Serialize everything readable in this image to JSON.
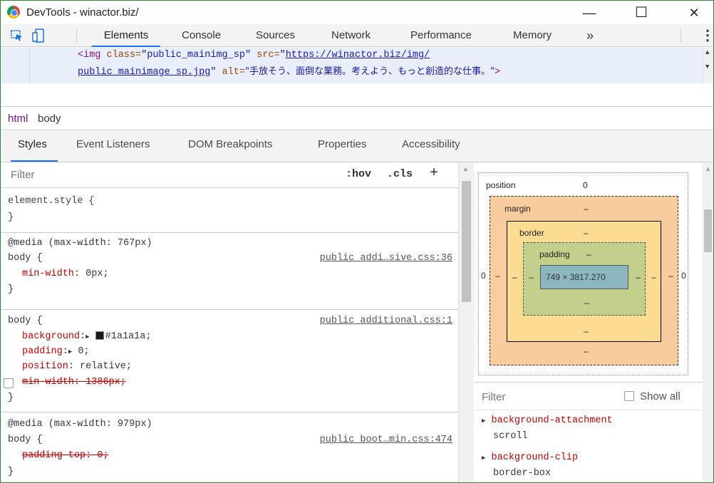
{
  "title": "DevTools - winactor.biz/",
  "window_controls": {
    "minimize": "—",
    "maximize": "☐",
    "close": "✕"
  },
  "tabs": [
    "Elements",
    "Console",
    "Sources",
    "Network",
    "Performance",
    "Memory"
  ],
  "more_tabs": "»",
  "kebab": "⋮",
  "dom": {
    "line1_tag": "<img",
    "line1_attr1": " class=",
    "line1_val1": "\"public_mainimg_sp\"",
    "line1_attr2": " src=",
    "line1_val2": "\"",
    "line1_link": "https://winactor.biz/img/",
    "line2_link": "public_mainimage_sp.jpg",
    "line2_val": "\"",
    "line2_attr": " alt=",
    "line2_alt": "\"手放そう、面倒な業務。考えよう、もっと創造的な仕事。\"",
    "line2_end": ">"
  },
  "breadcrumbs": [
    "html",
    "body"
  ],
  "subtabs": [
    "Styles",
    "Event Listeners",
    "DOM Breakpoints",
    "Properties",
    "Accessibility"
  ],
  "filter_placeholder": "Filter",
  "hov": ":hov",
  "cls": ".cls",
  "plus": "+",
  "rules": {
    "r1": {
      "l1": "element.style {",
      "l2": "}"
    },
    "r2": {
      "media": "@media (max-width: 767px)",
      "sel": "body {",
      "src": "public_addi…sive.css:36",
      "p1n": "min-width",
      "p1v": ": 0px;",
      "end": "}"
    },
    "r3": {
      "sel": "body {",
      "src": "public_additional.css:1",
      "p1n": "background",
      "p1v": "#1a1a1a;",
      "p2n": "padding",
      "p2v": "0;",
      "p3n": "position",
      "p3v": ": relative;",
      "p4": "min-width: 1386px;",
      "end": "}",
      "arrow": "▶"
    },
    "r4": {
      "media": "@media (max-width: 979px)",
      "sel": "body {",
      "src": "public_boot…min.css:474",
      "p1": "padding-top: 0;",
      "end": "}"
    }
  },
  "box_model": {
    "position_label": "position",
    "position_value": "0",
    "margin_label": "margin",
    "margin_value": "–",
    "border_label": "border",
    "border_value": "–",
    "padding_label": "padding",
    "padding_value": "–",
    "content": "749 × 3817.270",
    "left_pos": "0",
    "right_pos": "0",
    "dash": "–"
  },
  "computed": {
    "filter": "Filter",
    "show_all": "Show all",
    "items": [
      {
        "name": "background-attachment",
        "value": "scroll"
      },
      {
        "name": "background-clip",
        "value": "border-box"
      }
    ]
  },
  "colors": {
    "accent": "#1a73e8",
    "margin": "#f9cc9d",
    "border": "#fcdb92",
    "padding": "#c3d08b",
    "content": "#8cb6c0"
  }
}
